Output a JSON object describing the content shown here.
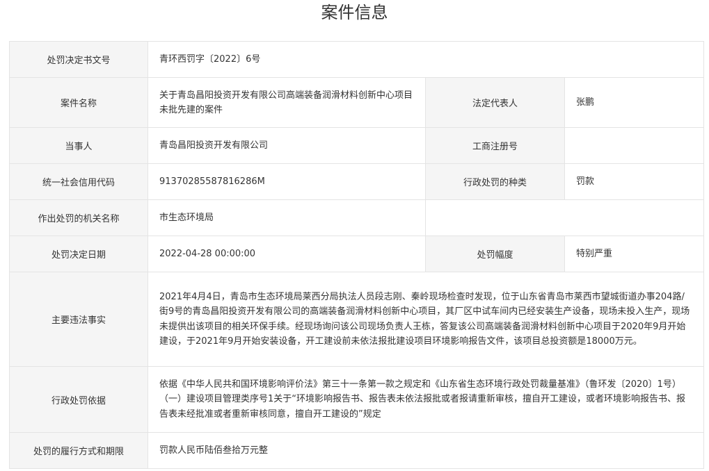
{
  "title": "案件信息",
  "rows": {
    "decision_no": {
      "label": "处罚决定书文号",
      "value": "青环西罚字〔2022〕6号"
    },
    "case_name": {
      "label": "案件名称",
      "value": "关于青岛昌阳投资开发有限公司高端装备润滑材料创新中心项目未批先建的案件"
    },
    "legal_rep": {
      "label": "法定代表人",
      "value": "张鹏"
    },
    "party": {
      "label": "当事人",
      "value": "青岛昌阳投资开发有限公司"
    },
    "business_reg": {
      "label": "工商注册号",
      "value": ""
    },
    "credit_code": {
      "label": "统一社会信用代码",
      "value": "91370285587816286M"
    },
    "penalty_type": {
      "label": "行政处罚的种类",
      "value": "罚款"
    },
    "authority": {
      "label": "作出处罚的机关名称",
      "value": "市生态环境局"
    },
    "decision_date": {
      "label": "处罚决定日期",
      "value": "2022-04-28 00:00:00"
    },
    "penalty_degree": {
      "label": "处罚幅度",
      "value": "特别严重"
    },
    "facts": {
      "label": "主要违法事实",
      "value": "2021年4月4日，青岛市生态环境局莱西分局执法人员段志刚、秦岭现场检查时发现，位于山东省青岛市莱西市望城街道办事204路/街9号的青岛昌阳投资开发有限公司的高端装备润滑材料创新中心项目，其厂区中试车间内已经安装生产设备，现场未投入生产，现场未提供出该项目的相关环保手续。经现场询问该公司现场负责人王栋，答复该公司高端装备润滑材料创新中心项目于2020年9月开始建设，于2021年9月开始安装设备，开工建设前未依法报批建设项目环境影响报告文件，该项目总投资额是18000万元。"
    },
    "basis": {
      "label": "行政处罚依据",
      "value": "依据《中华人民共和国环境影响评价法》第三十一条第一款之规定和《山东省生态环境行政处罚裁量基准》（鲁环发〔2020〕1号）（一）建设项目管理类序号1关于“环境影响报告书、报告表未依法报批或者报请重新审核，擅自开工建设，或者环境影响报告书、报告表未经批准或者重新审核同意，擅自开工建设的”规定"
    },
    "execution": {
      "label": "处罚的履行方式和期限",
      "value": "罚款人民币陆佰叁拾万元整"
    }
  }
}
